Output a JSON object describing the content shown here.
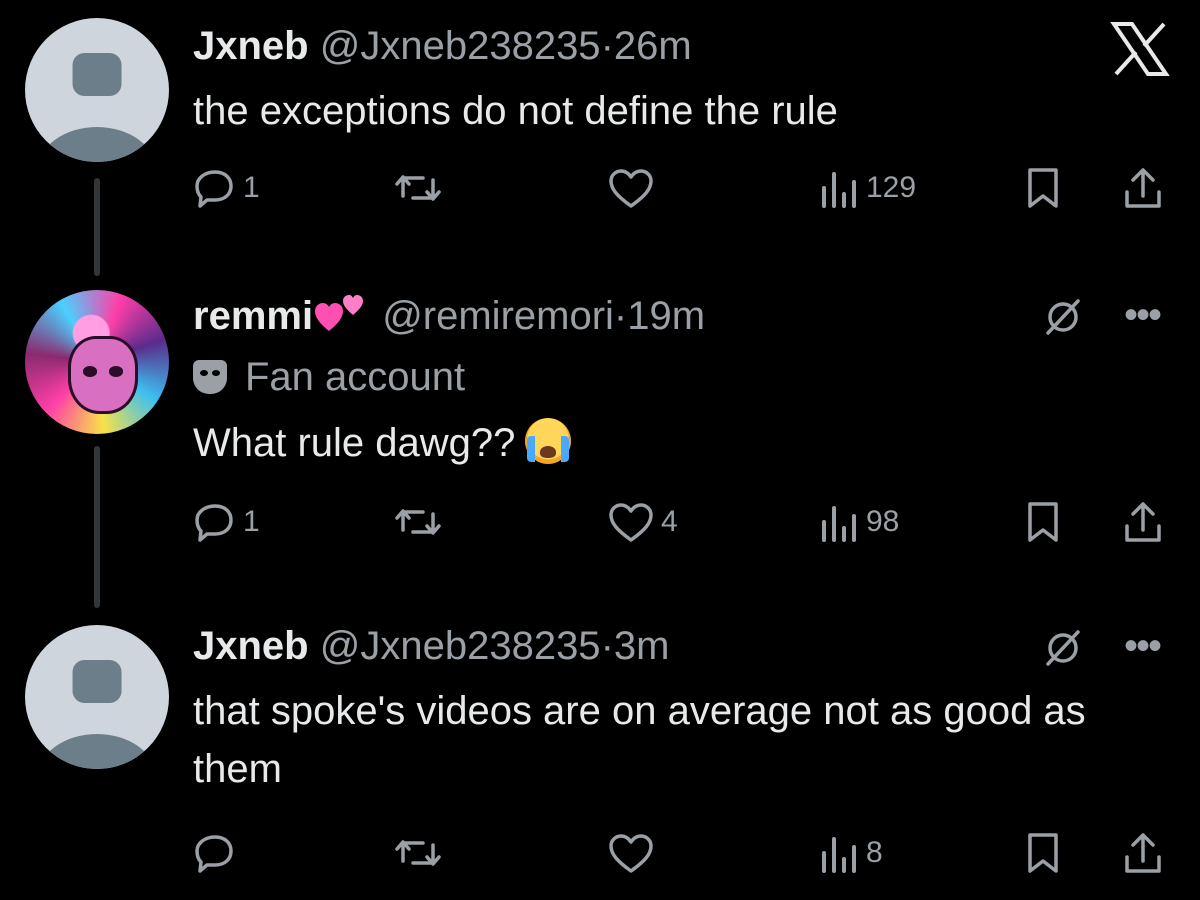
{
  "tweets": [
    {
      "name": "Jxneb",
      "handle": "@Jxneb238235",
      "separator": "·",
      "time": "26m",
      "text": "the exceptions do not define the rule",
      "replies": "1",
      "likes": "",
      "views": "129"
    },
    {
      "name": "remmi",
      "handle": "@remiremori",
      "separator": "·",
      "time": "19m",
      "badge": "Fan account",
      "text": "What rule dawg??",
      "replies": "1",
      "likes": "4",
      "views": "98"
    },
    {
      "name": "Jxneb",
      "handle": "@Jxneb238235",
      "separator": "·",
      "time": "3m",
      "text": "that spoke's videos are on average not as good as them",
      "replies": "",
      "likes": "",
      "views": "8"
    }
  ],
  "icons": {
    "brand": "x-logo-icon",
    "reply": "reply-icon",
    "repost": "repost-icon",
    "like": "like-icon",
    "views": "views-icon",
    "bookmark": "bookmark-icon",
    "share": "share-icon",
    "muted": "muted-icon",
    "more": "more-icon"
  },
  "colors": {
    "background": "#000000",
    "text": "#e7e9ea",
    "secondary": "#9aa0a6"
  }
}
